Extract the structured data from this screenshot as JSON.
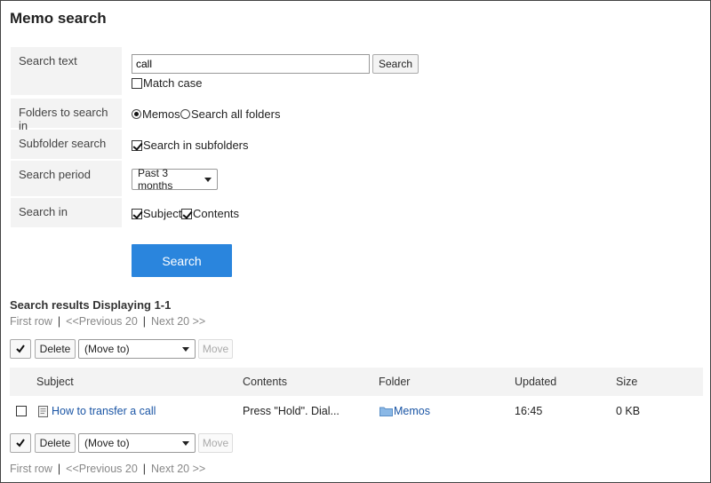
{
  "page": {
    "title": "Memo search"
  },
  "form": {
    "search_text": {
      "label": "Search text",
      "value": "call",
      "button": "Search",
      "match_case": "Match case"
    },
    "folders": {
      "label": "Folders to search in",
      "options": [
        "Memos",
        "Search all folders"
      ]
    },
    "subfolder": {
      "label": "Subfolder search",
      "option": "Search in subfolders"
    },
    "period": {
      "label": "Search period",
      "value": "Past 3 months"
    },
    "search_in": {
      "label": "Search in",
      "options": [
        "Subject",
        "Contents"
      ]
    },
    "submit": "Search"
  },
  "results": {
    "title": "Search results Displaying 1-1",
    "pager": {
      "first": "First row",
      "prev": "<<Previous 20",
      "next": "Next 20 >>"
    },
    "toolbar": {
      "delete": "Delete",
      "move_select": "(Move to)",
      "move": "Move"
    },
    "columns": [
      "Subject",
      "Contents",
      "Folder",
      "Updated",
      "Size"
    ],
    "rows": [
      {
        "subject": "How to transfer a call",
        "contents": "Press \"Hold\". Dial...",
        "folder": "Memos",
        "updated": "16:45",
        "size": "0 KB"
      }
    ]
  },
  "colors": {
    "primary": "#2a85dd",
    "link": "#1a55a5",
    "label_bg": "#f3f3f3"
  },
  "icons": {
    "select_all": "checkmark-icon",
    "memo": "memo-icon",
    "folder": "folder-icon"
  }
}
